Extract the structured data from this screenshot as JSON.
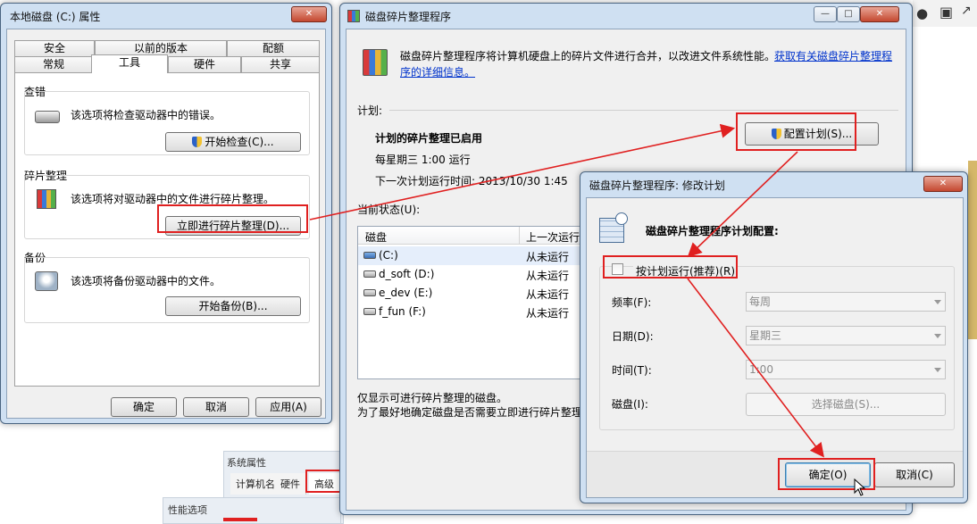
{
  "bg": {
    "sys_props_title": "系统属性",
    "sys_tabs": [
      "计算机名",
      "硬件",
      "高级"
    ],
    "perf_title": "性能选项"
  },
  "props": {
    "title": "本地磁盘 (C:) 属性",
    "tabs_row1": [
      "安全",
      "以前的版本",
      "配额"
    ],
    "tabs_row2": [
      "常规",
      "工具",
      "硬件",
      "共享"
    ],
    "check": {
      "heading": "查错",
      "desc": "该选项将检查驱动器中的错误。",
      "button": "开始检查(C)..."
    },
    "defrag": {
      "heading": "碎片整理",
      "desc": "该选项将对驱动器中的文件进行碎片整理。",
      "button": "立即进行碎片整理(D)..."
    },
    "backup": {
      "heading": "备份",
      "desc": "该选项将备份驱动器中的文件。",
      "button": "开始备份(B)..."
    },
    "ok": "确定",
    "cancel": "取消",
    "apply": "应用(A)"
  },
  "defrag": {
    "title": "磁盘碎片整理程序",
    "intro": "磁盘碎片整理程序将计算机硬盘上的碎片文件进行合并，以改进文件系统性能。",
    "link1": "获取有关磁盘碎片整理程",
    "link2": "序的详细信息。",
    "schedule_label": "计划:",
    "schedule_status": "计划的碎片整理已启用",
    "schedule_when": "每星期三 1:00 运行",
    "next_run": "下一次计划运行时间: 2013/10/30 1:45",
    "configure_btn": "配置计划(S)...",
    "current_status": "当前状态(U):",
    "columns": [
      "磁盘",
      "上一次运行"
    ],
    "disks": [
      {
        "name": "(C:)",
        "last": "从未运行"
      },
      {
        "name": "d_soft (D:)",
        "last": "从未运行"
      },
      {
        "name": "e_dev (E:)",
        "last": "从未运行"
      },
      {
        "name": "f_fun (F:)",
        "last": "从未运行"
      }
    ],
    "footer1": "仅显示可进行碎片整理的磁盘。",
    "footer2": "为了最好地确定磁盘是否需要立即进行碎片整理"
  },
  "modify": {
    "title": "磁盘碎片整理程序: 修改计划",
    "heading": "磁盘碎片整理程序计划配置:",
    "checkbox_label": "按计划运行(推荐)(R)",
    "frequency_label": "频率(F):",
    "frequency_value": "每周",
    "date_label": "日期(D):",
    "date_value": "星期三",
    "time_label": "时间(T):",
    "time_value": "1:00",
    "disk_label": "磁盘(I):",
    "select_disk": "选择磁盘(S)...",
    "ok": "确定(O)",
    "cancel": "取消(C)"
  },
  "colors": {
    "annotation_red": "#e02020"
  }
}
